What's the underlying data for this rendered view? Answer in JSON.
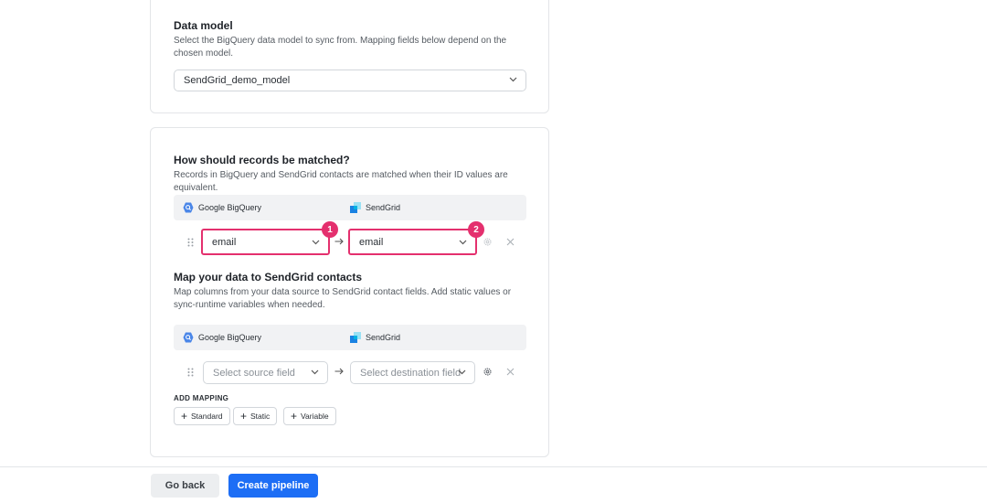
{
  "data_model": {
    "title": "Data model",
    "description": "Select the BigQuery data model to sync from. Mapping fields below depend on the chosen model.",
    "selected": "SendGrid_demo_model"
  },
  "matching": {
    "title": "How should records be matched?",
    "description": "Records in BigQuery and SendGrid contacts are matched when their ID values are equivalent.",
    "source_label": "Google BigQuery",
    "destination_label": "SendGrid",
    "source_value": "email",
    "destination_value": "email",
    "badge_1": "1",
    "badge_2": "2"
  },
  "mapping": {
    "title": "Map your data to SendGrid contacts",
    "description": "Map columns from your data source to SendGrid contact fields. Add static values or sync-runtime variables when needed.",
    "source_label": "Google BigQuery",
    "destination_label": "SendGrid",
    "source_placeholder": "Select source field",
    "destination_placeholder": "Select destination field",
    "add_mapping_label": "ADD MAPPING",
    "add_buttons": [
      "Standard",
      "Static",
      "Variable"
    ]
  },
  "footer": {
    "back_label": "Go back",
    "create_label": "Create pipeline"
  },
  "colors": {
    "accent": "#1d6ef5",
    "highlight": "#e4306e",
    "bigquery": "#4a86e8",
    "sendgrid": "#1a82e2"
  },
  "icons": {
    "source": "google-bigquery-icon",
    "destination": "sendgrid-icon",
    "drag": "drag-handle-icon",
    "arrow": "arrow-right-icon",
    "settings": "gear-icon",
    "remove": "close-icon",
    "dropdown": "chevron-down-icon",
    "add": "plus-icon"
  }
}
